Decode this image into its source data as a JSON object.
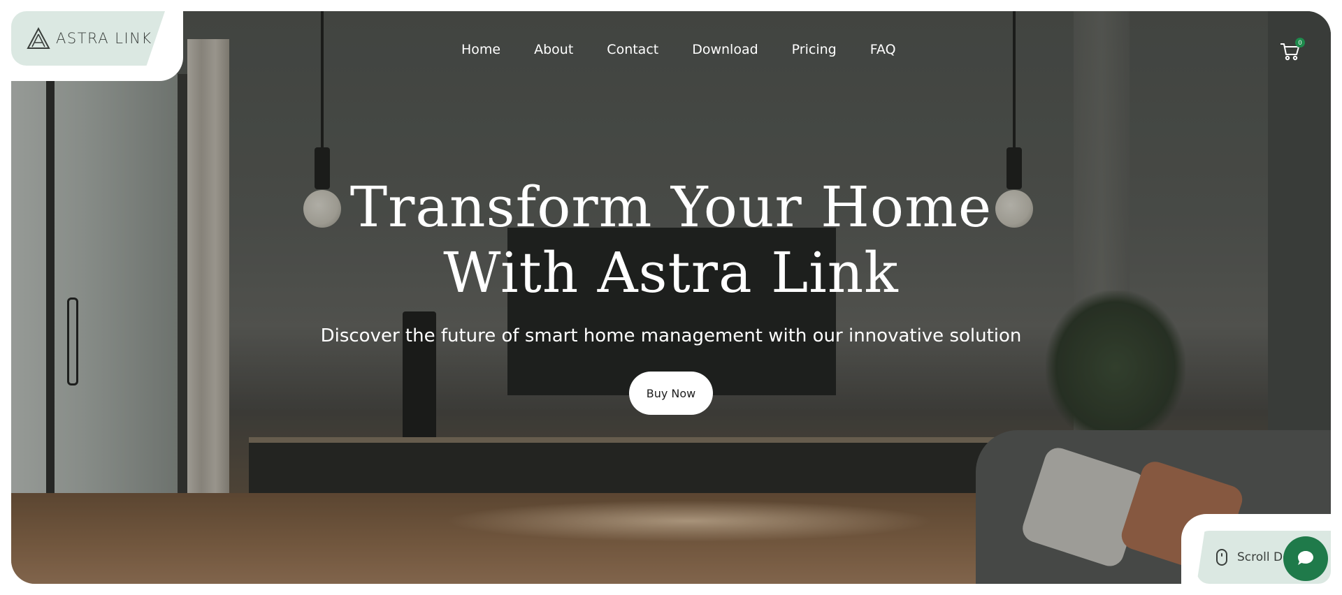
{
  "brand": {
    "name": "ASTRA LINK"
  },
  "nav": {
    "items": [
      {
        "label": "Home"
      },
      {
        "label": "About"
      },
      {
        "label": "Contact"
      },
      {
        "label": "Download"
      },
      {
        "label": "Pricing"
      },
      {
        "label": "FAQ"
      }
    ]
  },
  "cart": {
    "count": "0",
    "icon": "cart-icon"
  },
  "hero": {
    "title_line1": "Transform Your Home",
    "title_line2": "With Astra Link",
    "subtitle": "Discover the future of smart home management with our innovative solution",
    "cta_label": "Buy Now"
  },
  "scroll": {
    "label": "Scroll Down",
    "icon": "mouse-icon"
  },
  "chat": {
    "icon": "chat-icon"
  },
  "colors": {
    "accent_green": "#1f7a4a",
    "pill_bg": "#dbe8e2",
    "badge_green": "#1e8a4c",
    "text_dark": "#3a3f3c"
  }
}
